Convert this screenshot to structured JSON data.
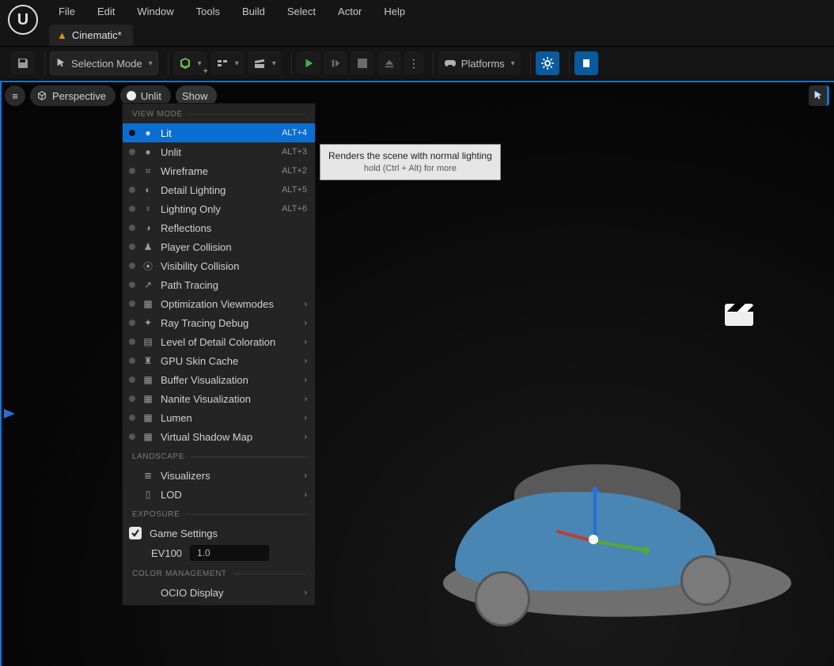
{
  "menu": {
    "items": [
      "File",
      "Edit",
      "Window",
      "Tools",
      "Build",
      "Select",
      "Actor",
      "Help"
    ]
  },
  "tab": {
    "label": "Cinematic*"
  },
  "toolbar": {
    "selection_mode": "Selection Mode",
    "platforms": "Platforms"
  },
  "viewport_pills": {
    "perspective": "Perspective",
    "lit_mode": "Unlit",
    "show": "Show"
  },
  "dropdown": {
    "headers": {
      "view_mode": "VIEW MODE",
      "landscape": "LANDSCAPE",
      "exposure": "EXPOSURE",
      "color_mgmt": "COLOR MANAGEMENT"
    },
    "items_view": [
      {
        "label": "Lit",
        "shortcut": "ALT+4",
        "sel": true,
        "sub": false
      },
      {
        "label": "Unlit",
        "shortcut": "ALT+3",
        "sel": false,
        "sub": false
      },
      {
        "label": "Wireframe",
        "shortcut": "ALT+2",
        "sel": false,
        "sub": false
      },
      {
        "label": "Detail Lighting",
        "shortcut": "ALT+5",
        "sel": false,
        "sub": false
      },
      {
        "label": "Lighting Only",
        "shortcut": "ALT+6",
        "sel": false,
        "sub": false
      },
      {
        "label": "Reflections",
        "shortcut": "",
        "sel": false,
        "sub": false
      },
      {
        "label": "Player Collision",
        "shortcut": "",
        "sel": false,
        "sub": false
      },
      {
        "label": "Visibility Collision",
        "shortcut": "",
        "sel": false,
        "sub": false
      },
      {
        "label": "Path Tracing",
        "shortcut": "",
        "sel": false,
        "sub": false
      },
      {
        "label": "Optimization Viewmodes",
        "shortcut": "",
        "sel": false,
        "sub": true
      },
      {
        "label": "Ray Tracing Debug",
        "shortcut": "",
        "sel": false,
        "sub": true
      },
      {
        "label": "Level of Detail Coloration",
        "shortcut": "",
        "sel": false,
        "sub": true
      },
      {
        "label": "GPU Skin Cache",
        "shortcut": "",
        "sel": false,
        "sub": true
      },
      {
        "label": "Buffer Visualization",
        "shortcut": "",
        "sel": false,
        "sub": true
      },
      {
        "label": "Nanite Visualization",
        "shortcut": "",
        "sel": false,
        "sub": true
      },
      {
        "label": "Lumen",
        "shortcut": "",
        "sel": false,
        "sub": true
      },
      {
        "label": "Virtual Shadow Map",
        "shortcut": "",
        "sel": false,
        "sub": true
      }
    ],
    "items_landscape": [
      {
        "label": "Visualizers",
        "sub": true
      },
      {
        "label": "LOD",
        "sub": true
      }
    ],
    "game_settings_label": "Game Settings",
    "ev100_label": "EV100",
    "ev100_value": "1.0",
    "ocio_label": "OCIO Display"
  },
  "tooltip": {
    "line1": "Renders the scene with normal lighting",
    "line2": "hold (Ctrl + Alt) for more"
  }
}
